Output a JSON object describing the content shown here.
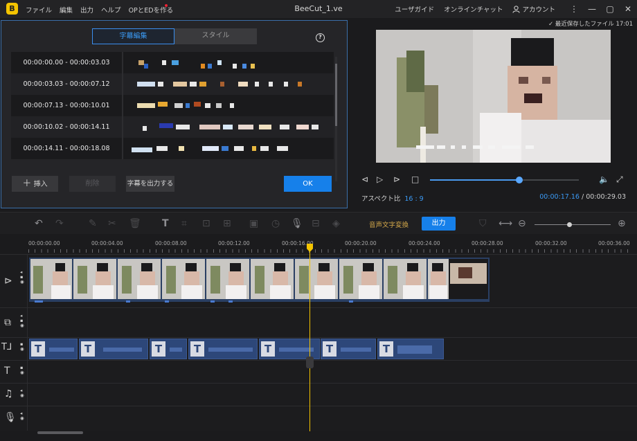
{
  "app": {
    "window_title": "BeeCut_1.ve",
    "logo_char": "B",
    "menu": [
      "ファイル",
      "編集",
      "出力",
      "ヘルプ",
      "OPとEDを作る"
    ],
    "guide": "ユーザガイド",
    "chat": "オンラインチャット",
    "account": "アカウント"
  },
  "editor": {
    "tab_active": "字幕編集",
    "tab_style": "スタイル",
    "help": "?",
    "rows": [
      {
        "time": "00:00:00.00 - 00:00:03.03"
      },
      {
        "time": "00:00:03.03 - 00:00:07.12"
      },
      {
        "time": "00:00:07.13 - 00:00:10.01"
      },
      {
        "time": "00:00:10.02 - 00:00:14.11"
      },
      {
        "time": "00:00:14.11 - 00:00:18.08"
      }
    ],
    "insert_label": "挿入",
    "delete_label": "削除",
    "export_label": "字幕を出力する",
    "ok_label": "OK"
  },
  "preview": {
    "saved_label": "最近保存したファイル 17:01",
    "aspect_label": "アスペクト比",
    "aspect_value": "16 : 9",
    "current_time": "00:00:17.16",
    "total_time": "00:00:29.03",
    "progress_fraction": 0.6
  },
  "toolbar": {
    "asr_label": "音声文字変換",
    "export_label": "出力"
  },
  "ruler": {
    "labels": [
      "00:00:00.00",
      "00:00:04.00",
      "00:00:08.00",
      "00:00:12.00",
      "00:00:16.00",
      "00:00:20.00",
      "00:00:24.00",
      "00:00:28.00",
      "00:00:32.00",
      "00:00:36.00"
    ]
  },
  "colors": {
    "accent": "#1680ea",
    "playhead": "#f4c400",
    "asr": "#d4a84a"
  }
}
